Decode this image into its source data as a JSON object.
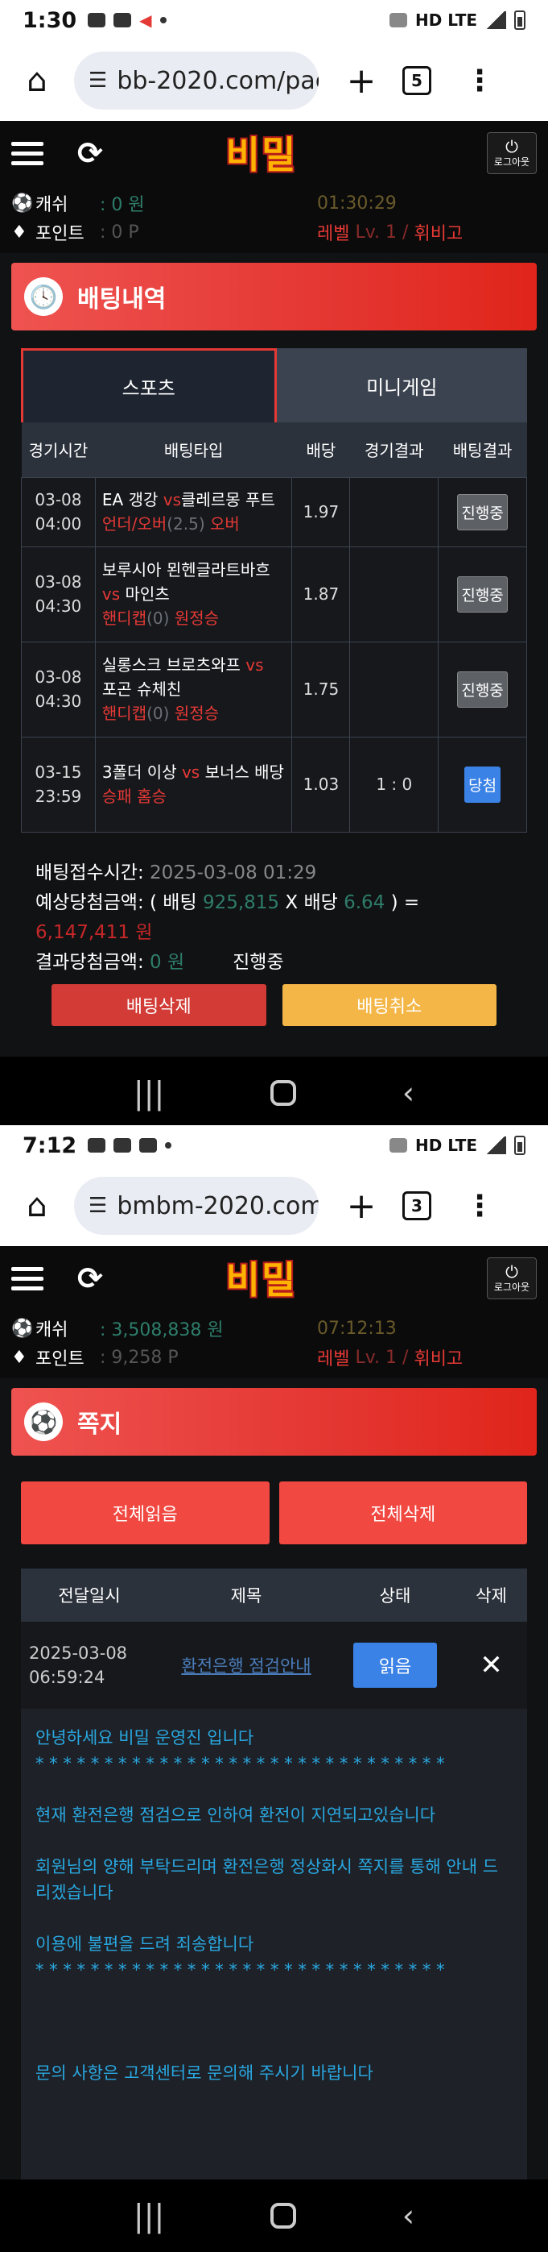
{
  "shot1": {
    "status": {
      "time": "1:30"
    },
    "browser": {
      "url": "bb-2020.com/pag",
      "tab_count": "5"
    },
    "header": {
      "logo": "비밀",
      "logout_label": "로그아웃"
    },
    "info": {
      "cash_label": "캐쉬",
      "cash_value": ": 0 원",
      "time": "01:30:29",
      "point_label": "포인트",
      "point_value": ": 0 P",
      "level_label": "레벨",
      "level_value": "Lv. 1 /",
      "level_name": "휘비고"
    },
    "banner": {
      "title": "배팅내역"
    },
    "tabs": [
      "스포츠",
      "미니게임"
    ],
    "table": {
      "headers": [
        "경기시간",
        "배팅타입",
        "배당",
        "경기결과",
        "배팅결과"
      ],
      "rows": [
        {
          "date": "03-08",
          "time": "04:00",
          "team1": "EA 갱강",
          "vs": "vs",
          "team2": "클레르몽 푸트",
          "sel_a": "언더/오버",
          "sel_b": "(2.5)",
          "sel_c": "오버",
          "odds": "1.97",
          "result": "",
          "status": "진행중"
        },
        {
          "date": "03-08",
          "time": "04:30",
          "team1": "보루시아 묀헨글라트바흐",
          "vs": "vs",
          "team2": "마인츠",
          "sel_a": "핸디캡",
          "sel_b": "(0)",
          "sel_c": "원정승",
          "odds": "1.87",
          "result": "",
          "status": "진행중"
        },
        {
          "date": "03-08",
          "time": "04:30",
          "team1": "실롱스크 브로츠와프",
          "vs": "vs",
          "team2": "포곤 슈체친",
          "sel_a": "핸디캡",
          "sel_b": "(0)",
          "sel_c": "원정승",
          "odds": "1.75",
          "result": "",
          "status": "진행중"
        },
        {
          "date": "03-15",
          "time": "23:59",
          "team1": "3폴더 이상",
          "vs": "vs",
          "team2": "보너스 배당",
          "sel_a": "승패",
          "sel_b": "",
          "sel_c": "홈승",
          "odds": "1.03",
          "result": "1 : 0",
          "status": "당첨"
        }
      ]
    },
    "summary": {
      "time_label": "배팅접수시간:",
      "time_value": "2025-03-08 01:29",
      "expected_label": "예상당첨금액: ( 배팅",
      "bet_amount": "925,815",
      "x": "X 배당",
      "odds": "6.64",
      "close": ") =",
      "expected_value": "6,147,411 원",
      "result_label": "결과당첨금액:",
      "result_value": "0 원",
      "state": "진행중"
    },
    "buttons": {
      "delete": "배팅삭제",
      "cancel": "배팅취소"
    }
  },
  "shot2": {
    "status": {
      "time": "7:12"
    },
    "browser": {
      "url": "bmbm-2020.com",
      "tab_count": "3"
    },
    "header": {
      "logo": "비밀",
      "logout_label": "로그아웃"
    },
    "info": {
      "cash_label": "캐쉬",
      "cash_value": ": 3,508,838 원",
      "time": "07:12:13",
      "point_label": "포인트",
      "point_value": ": 9,258 P",
      "level_label": "레벨",
      "level_value": "Lv. 1 /",
      "level_name": "휘비고"
    },
    "banner": {
      "title": "쪽지"
    },
    "buttons": {
      "read_all": "전체읽음",
      "delete_all": "전체삭제"
    },
    "table": {
      "headers": [
        "전달일시",
        "제목",
        "상태",
        "삭제"
      ],
      "row": {
        "date": "2025-03-08",
        "time": "06:59:24",
        "title": "환전은행 점검안내",
        "status": "읽음",
        "delete": "✕"
      }
    },
    "message": {
      "line1": "안녕하세요 비밀 운영진 입니다",
      "stars1": "* * * * * * * * * * * * * * * * * * * * * * * * * * * * * *",
      "line2": "현재 환전은행 점검으로 인하여 환전이 지연되고있습니다",
      "line3": "회원님의 양해 부탁드리며 환전은행 정상화시 쪽지를 통해 안내 드리겠습니다",
      "line4": "이용에 불편을 드려 죄송합니다",
      "stars2": "* * * * * * * * * * * * * * * * * * * * * * * * * * * * * *",
      "line5": "문의 사항은 고객센터로 문의해 주시기 바랍니다"
    }
  }
}
